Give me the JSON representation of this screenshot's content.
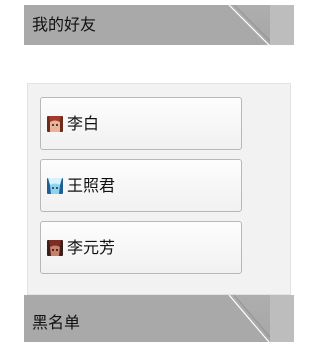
{
  "groups": {
    "friends": {
      "title": "我的好友"
    },
    "blacklist": {
      "title": "黑名单"
    }
  },
  "friends": [
    {
      "name": "李白",
      "avatar_icon": "li-bai-avatar-icon",
      "avatar_colors": [
        "#6b2c1e",
        "#e7b49a",
        "#a33a2a"
      ]
    },
    {
      "name": "王照君",
      "avatar_icon": "wang-zhaojun-avatar-icon",
      "avatar_colors": [
        "#1f5f93",
        "#8fd3f0",
        "#d8f2ff"
      ]
    },
    {
      "name": "李元芳",
      "avatar_icon": "li-yuanfang-avatar-icon",
      "avatar_colors": [
        "#3a1f1a",
        "#c9806a",
        "#7a2c25"
      ]
    }
  ],
  "colors": {
    "header_bg": "#a9a9a9",
    "list_bg": "#f2f2f2",
    "button_border": "#b8b8b8"
  }
}
